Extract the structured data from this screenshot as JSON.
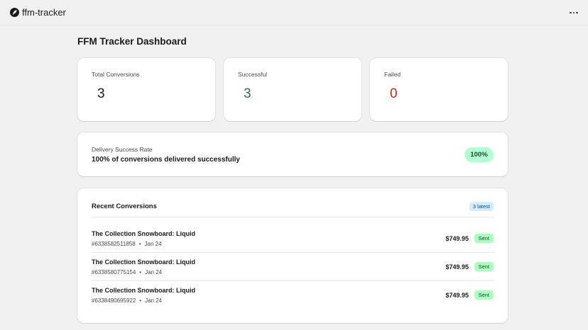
{
  "app": {
    "title": "ffm-tracker",
    "logo_icon": "feather-icon"
  },
  "header": {
    "more_icon": "more-horizontal-icon"
  },
  "page": {
    "title": "FFM Tracker Dashboard"
  },
  "stats": [
    {
      "label": "Total Conversions",
      "value": "3",
      "color": "#1a1a1a"
    },
    {
      "label": "Successful",
      "value": "3",
      "color": "#2e6b52"
    },
    {
      "label": "Failed",
      "value": "0",
      "color": "#c5280c"
    }
  ],
  "delivery": {
    "label": "Delivery Success Rate",
    "description": "100% of conversions delivered successfully",
    "rate": "100%"
  },
  "recent": {
    "title": "Recent Conversions",
    "badge": "3 latest",
    "rows": [
      {
        "title": "The Collection Snowboard: Liquid",
        "order": "#6338582511858",
        "date": "Jan 24",
        "price": "$749.95",
        "status": "Sent"
      },
      {
        "title": "The Collection Snowboard: Liquid",
        "order": "#6338580775154",
        "date": "Jan 24",
        "price": "$749.95",
        "status": "Sent"
      },
      {
        "title": "The Collection Snowboard: Liquid",
        "order": "#6338490695922",
        "date": "Jan 24",
        "price": "$749.95",
        "status": "Sent"
      }
    ],
    "separator": "•"
  },
  "colors": {
    "page_bg": "#f1f1f1",
    "success_badge_bg": "#b4fed2",
    "status_badge_bg": "#affebf",
    "info_badge_bg": "#d5ebff"
  }
}
